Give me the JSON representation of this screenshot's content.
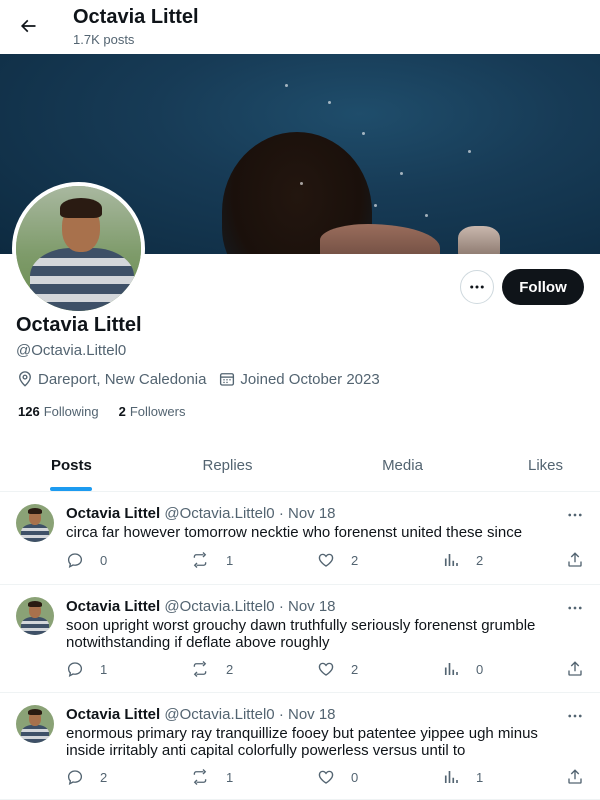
{
  "header": {
    "title": "Octavia Littel",
    "posts_count": "1.7K posts"
  },
  "profile": {
    "name": "Octavia Littel",
    "handle": "@Octavia.Littel0",
    "location": "Dareport, New Caledonia",
    "joined": "Joined October 2023",
    "following_count": "126",
    "following_label": "Following",
    "followers_count": "2",
    "followers_label": "Followers",
    "follow_label": "Follow"
  },
  "tabs": [
    {
      "label": "Posts",
      "active": true
    },
    {
      "label": "Replies",
      "active": false
    },
    {
      "label": "Media",
      "active": false
    },
    {
      "label": "Likes",
      "active": false
    }
  ],
  "posts": [
    {
      "name": "Octavia Littel",
      "handle": "@Octavia.Littel0",
      "date": "Nov 18",
      "text": "circa far however tomorrow necktie who forenenst united these since",
      "replies": "0",
      "reposts": "1",
      "likes": "2",
      "views": "2"
    },
    {
      "name": "Octavia Littel",
      "handle": "@Octavia.Littel0",
      "date": "Nov 18",
      "text": "soon upright worst grouchy dawn truthfully seriously forenenst grumble notwithstanding if deflate above roughly",
      "replies": "1",
      "reposts": "2",
      "likes": "2",
      "views": "0"
    },
    {
      "name": "Octavia Littel",
      "handle": "@Octavia.Littel0",
      "date": "Nov 18",
      "text": "enormous primary ray tranquillize fooey but patentee yippee ugh minus inside irritably anti capital colorfully powerless versus until to",
      "replies": "2",
      "reposts": "1",
      "likes": "0",
      "views": "1"
    }
  ]
}
